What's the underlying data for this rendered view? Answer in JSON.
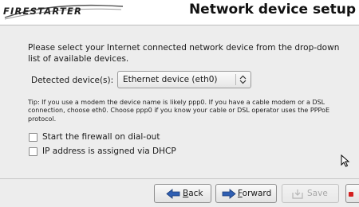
{
  "header": {
    "logo_text": "FIRESTARTER",
    "title": "Network device setup"
  },
  "intro_text": "Please select your Internet connected network device from the drop-down list of available devices.",
  "device": {
    "label": "Detected device(s):",
    "selected": "Ethernet device (eth0)"
  },
  "tip_text": "Tip: If you use a modem the device name is likely ppp0. If you have a cable modem or a DSL connection, choose eth0. Choose ppp0 if you know your cable or DSL operator uses the PPPoE protocol.",
  "options": [
    {
      "label": "Start the firewall on dial-out",
      "checked": false
    },
    {
      "label": "IP address is assigned via DHCP",
      "checked": false
    }
  ],
  "buttons": {
    "back_first": "B",
    "back_rest": "ack",
    "forward_first": "F",
    "forward_rest": "orward",
    "save": "Save"
  },
  "colors": {
    "arrow_blue": "#2f5fb3",
    "accent_red": "#d42020"
  },
  "icons": {
    "back": "arrow-left-icon",
    "forward": "arrow-right-icon",
    "save": "save-icon",
    "dropdown": "updown-arrows-icon"
  }
}
